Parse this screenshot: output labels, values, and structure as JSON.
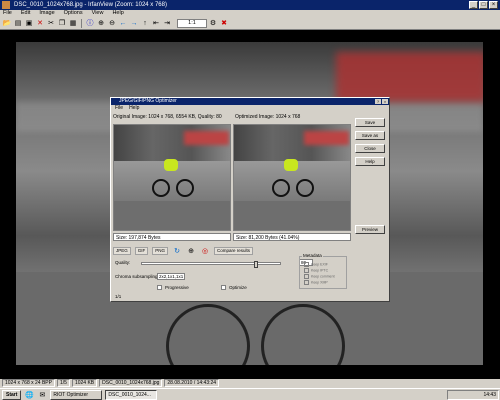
{
  "window": {
    "title": "DSC_0010_1024x768.jpg - IrfanView (Zoom: 1024 x 768)"
  },
  "menu": [
    "File",
    "Edit",
    "Image",
    "Options",
    "View",
    "Help"
  ],
  "toolbar": {
    "zoom_value": "1:1"
  },
  "dialog": {
    "title": "JPEG/GIF/PNG Optimizer",
    "menu": [
      "File",
      "Help"
    ],
    "orig_label": "Original Image: 1024 x 768, 6554 KB, Quality: 80",
    "optimized_label": "Optimized Image: 1024 x 768",
    "orig_status": "Size: 197,874 Bytes",
    "opt_status": "Size: 81,200 Bytes (41.04%)",
    "buttons": {
      "save": "Save",
      "save_as": "Save as",
      "close": "Close",
      "help": "Help",
      "preview": "Preview"
    },
    "tabs": {
      "jpeg": "JPEG",
      "gif": "GIF",
      "png": "PNG",
      "compare": "Compare results"
    },
    "quality_label": "Quality:",
    "quality_value": "80",
    "subsampling_label": "Chroma subsampling:",
    "subsampling_value": "2x2,1x1,1x1",
    "progressive_label": "Progressive",
    "optimize_label": "Optimize",
    "metadata_group": "Metadata",
    "metadata_items": [
      "Keep EXIF",
      "Keep IPTC",
      "Keep comment",
      "Keep XMP"
    ],
    "page": "1/1",
    "copy_label": "Copy to clipboard"
  },
  "statusbar": [
    "1024 x 768 x 24 BPP",
    "1/5",
    "1024 KB",
    "DSC_0010_1024x768.jpg",
    "28.08.2010 / 14:43:24"
  ],
  "taskbar": {
    "start": "Start",
    "tasks": [
      "RIOT Optimizer",
      "DSC_0010_1024..."
    ],
    "tray_time": "14:43"
  }
}
